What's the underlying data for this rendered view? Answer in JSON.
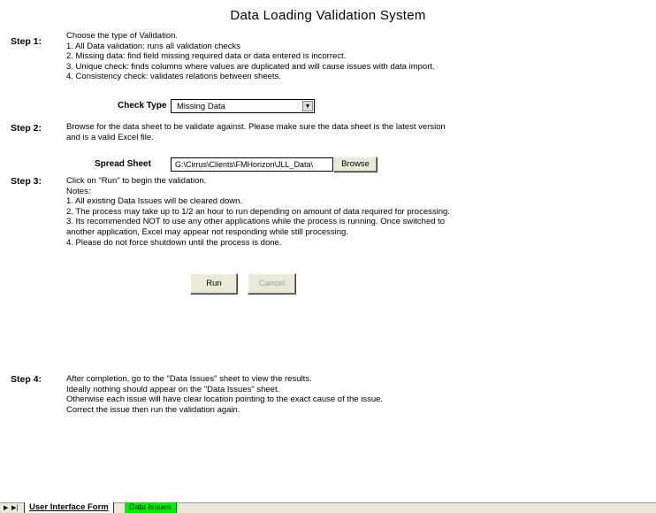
{
  "title": "Data Loading Validation System",
  "step1": {
    "label": "Step 1:",
    "lines": [
      "Choose the type of Validation.",
      "1. All Data validation: runs all validation checks",
      "2. Missing data: find field missing required data or data entered is incorrect.",
      "3. Unique check: finds columns where values are duplicated and will cause issues with data import.",
      "4. Consistency check: validates relations between sheets."
    ],
    "check_type_label": "Check Type",
    "check_type_value": "Missing Data"
  },
  "step2": {
    "label": "Step 2:",
    "lines": [
      "Browse for the data sheet to be validate against. Please make sure the data sheet is the latest version",
      "and is a valid Excel file."
    ],
    "spread_sheet_label": "Spread Sheet",
    "spread_sheet_value": "G:\\Cirrus\\Clients\\FMHorizon\\JLL_Data\\",
    "browse_label": "Browse"
  },
  "step3": {
    "label": "Step 3:",
    "lines": [
      "Click on \"Run\" to begin the validation.",
      "Notes:",
      "1. All existing Data Issues will be cleared down.",
      "2. The process may take up to 1/2 an hour to run depending on amount of data required for processing.",
      "3. Its recommended NOT to use any other applications while the process is running. Once switched to",
      "another application, Excel may appear not responding while still processing.",
      "4. Please do not force shutdown until the process is done."
    ],
    "run_label": "Run",
    "cancel_label": "Cancel"
  },
  "step4": {
    "label": "Step 4:",
    "lines": [
      "After completion, go to the \"Data Issues\" sheet to view the results.",
      "Ideally nothing should appear on the \"Data Issues\" sheet.",
      "Otherwise each issue will have clear location pointing to the exact cause of the issue.",
      "Correct the issue then run the validation again."
    ]
  },
  "tabs": {
    "nav_first": "▶",
    "nav_last": "▶|",
    "active": "User Interface Form",
    "other": "Data Issues",
    "other_color": "#00ee00"
  }
}
